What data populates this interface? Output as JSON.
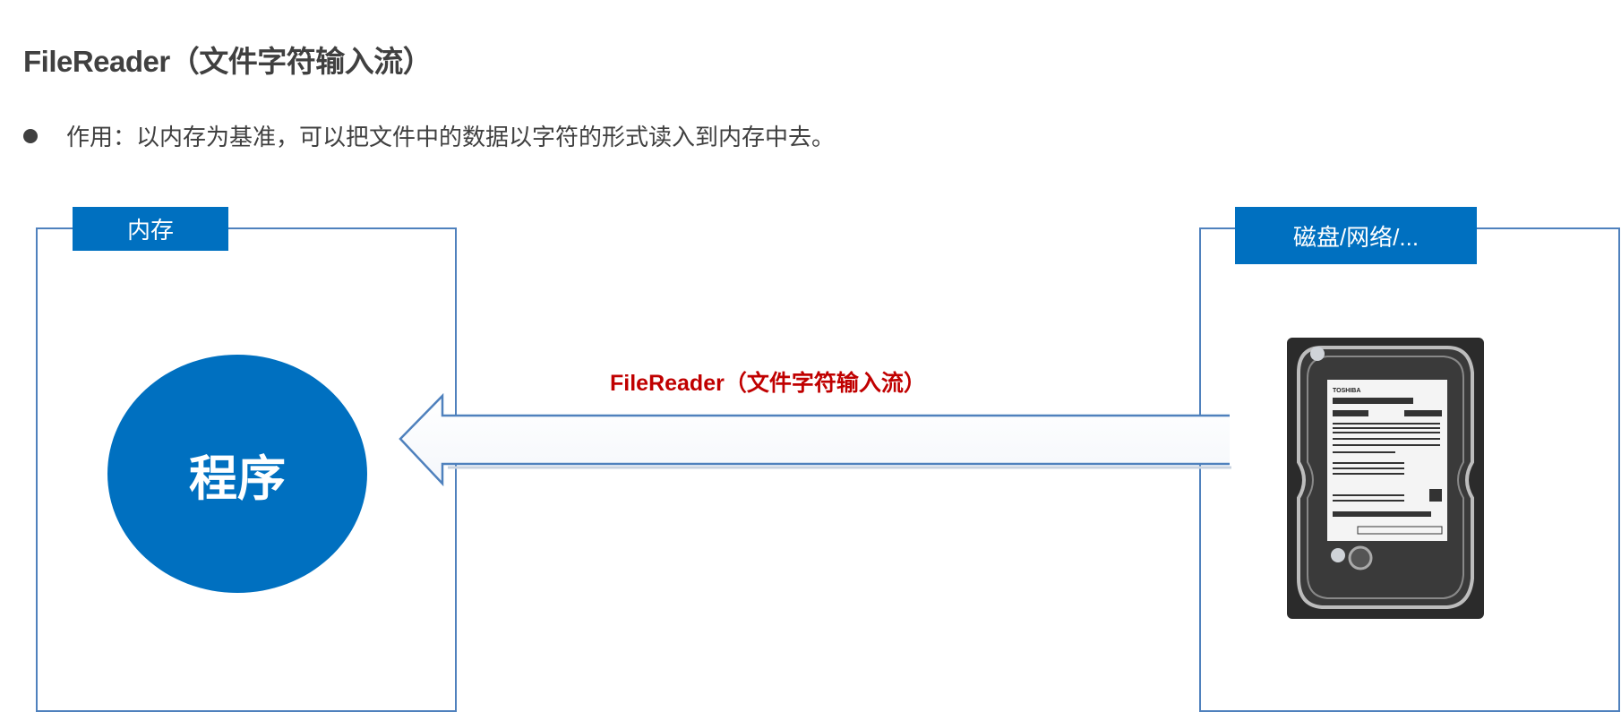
{
  "title": "FileReader（文件字符输入流）",
  "bullet": "作用：以内存为基准，可以把文件中的数据以字符的形式读入到内存中去。",
  "left_panel": {
    "tag": "内存",
    "circle_label": "程序"
  },
  "right_panel": {
    "tag": "磁盘/网络/...",
    "image": "hard-disk-drive"
  },
  "arrow": {
    "label": "FileReader（文件字符输入流）",
    "direction": "right-to-left"
  },
  "colors": {
    "accent": "#0070C0",
    "border": "#4F81BD",
    "arrow_label": "#C00000",
    "text": "#404040"
  }
}
